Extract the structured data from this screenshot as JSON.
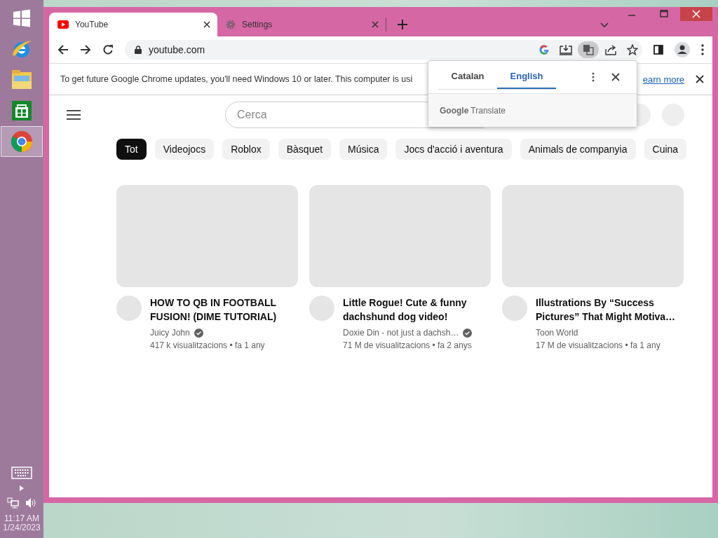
{
  "taskbar": {
    "apps": [
      {
        "kind": "start",
        "selected": false
      },
      {
        "kind": "browser-e",
        "selected": false
      },
      {
        "kind": "folder",
        "selected": false
      },
      {
        "kind": "store",
        "selected": false
      },
      {
        "kind": "chrome",
        "selected": true
      }
    ],
    "clock": {
      "time": "11:17 AM",
      "date": "1/24/2023"
    }
  },
  "tabs": [
    {
      "title": "YouTube",
      "kind": "youtube",
      "selected": true
    },
    {
      "title": "Settings",
      "kind": "settings",
      "selected": false
    }
  ],
  "address": "youtube.com",
  "infobar": {
    "text": "To get future Google Chrome updates, you'll need Windows 10 or later. This computer is usi",
    "link": "earn more"
  },
  "translate": {
    "languages": [
      {
        "name": "Catalan",
        "selected": false
      },
      {
        "name": "English",
        "selected": true
      }
    ],
    "brand": "Google",
    "product": "Translate"
  },
  "search": {
    "placeholder": "Cerca"
  },
  "chips": [
    {
      "label": "Tot",
      "selected": true
    },
    {
      "label": "Videojocs",
      "selected": false
    },
    {
      "label": "Roblox",
      "selected": false
    },
    {
      "label": "Bàsquet",
      "selected": false
    },
    {
      "label": "Música",
      "selected": false
    },
    {
      "label": "Jocs d'acció i aventura",
      "selected": false
    },
    {
      "label": "Animals de companyia",
      "selected": false
    },
    {
      "label": "Cuina",
      "selected": false
    }
  ],
  "videos": [
    {
      "title": "HOW TO QB IN FOOTBALL FUSION! (DIME TUTORIAL)",
      "channel": "Juicy John",
      "verified": true,
      "stats": "417 k visualitzacions • fa 1 any"
    },
    {
      "title": "Little Rogue! Cute & funny dachshund dog video!",
      "channel": "Doxie Din - not just a dachsh…",
      "verified": true,
      "stats": "71 M de visualitzacions • fa 2 anys"
    },
    {
      "title": "Illustrations By “Success Pictures” That Might Motiva…",
      "channel": "Toon World",
      "verified": false,
      "stats": "17 M de visualitzacions • fa 1 any"
    }
  ]
}
